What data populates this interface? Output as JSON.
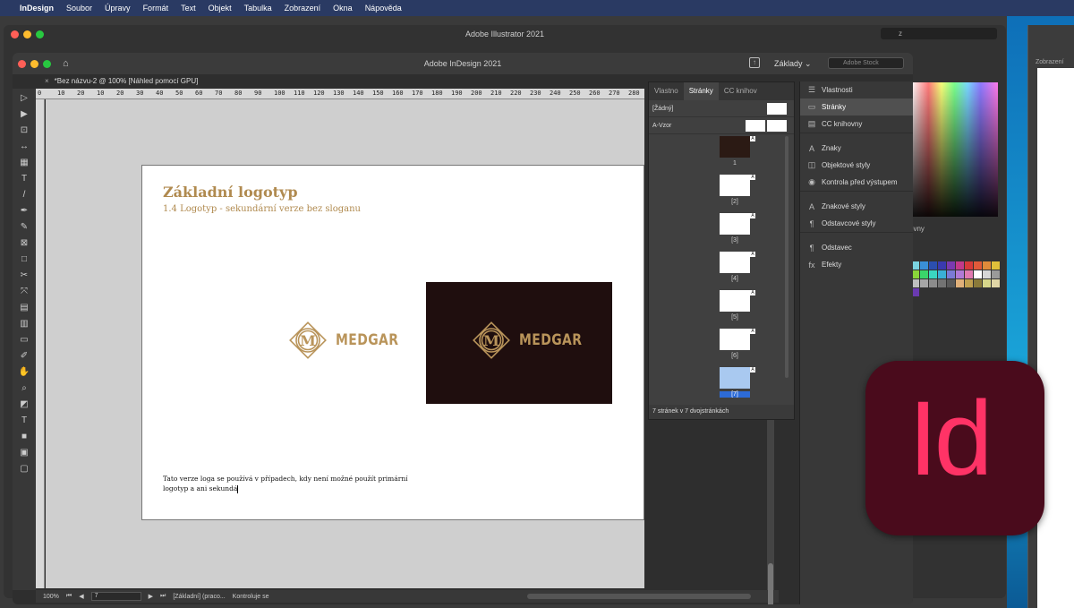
{
  "menubar": {
    "app": "InDesign",
    "items": [
      "Soubor",
      "Úpravy",
      "Formát",
      "Text",
      "Objekt",
      "Tabulka",
      "Zobrazení",
      "Okna",
      "Nápověda"
    ]
  },
  "illustrator": {
    "title": "Adobe Illustrator 2021",
    "search": "z",
    "swatch_label": "ovny",
    "swatches": [
      "#7ad3e0",
      "#3a8fd6",
      "#2b4fb0",
      "#3a3ab0",
      "#7a3ab0",
      "#c23a8a",
      "#d63a3a",
      "#e05a3a",
      "#e08a3a",
      "#e0c03a",
      "#8ad63a",
      "#3ad66a",
      "#3ad6c0",
      "#3ab0d6",
      "#7a7ad6",
      "#b07ad6",
      "#e07ab0",
      "#ffffff",
      "#d6d6d6",
      "#9a9a9a",
      "#bfbfbf",
      "#a6a6a6",
      "#8c8c8c",
      "#737373",
      "#595959",
      "#e0b07a",
      "#c0a050",
      "#8a7a3a",
      "#d6d68a",
      "#e0d6a6",
      "#6a3ab0"
    ]
  },
  "desktop": {
    "window_title": "Zobrazení"
  },
  "indesign": {
    "title": "Adobe InDesign 2021",
    "workspace": "Základy",
    "stock_placeholder": "Adobe Stock",
    "doc_tab": "*Bez názvu-2 @ 100% [Náhled pomocí GPU]",
    "ruler_marks": [
      "0",
      "10",
      "20",
      "10",
      "20",
      "30",
      "40",
      "50",
      "60",
      "70",
      "80",
      "90",
      "100",
      "110",
      "120",
      "130",
      "140",
      "150",
      "160",
      "170",
      "180",
      "190",
      "200",
      "210",
      "220",
      "230",
      "240",
      "250",
      "260",
      "270",
      "280"
    ]
  },
  "page": {
    "heading": "Základní logotyp",
    "subheading": "1.4 Logotyp - sekundární verze bez sloganu",
    "logo_word": "MEDGAR",
    "body": "Tato verze loga se používá v případech, kdy není možné použít primární logotyp a ani sekundá",
    "brand_gold": "#b08a4f",
    "brand_dark": "#1f0e0e"
  },
  "status": {
    "zoom": "100%",
    "page": "7",
    "profile": "[Základní] (praco...",
    "preflight": "Kontroluje se"
  },
  "pages_panel": {
    "tabs": [
      "Vlastno",
      "Stránky",
      "CC knihov"
    ],
    "none_label": "[Žádný]",
    "master_label": "A-Vzor",
    "pages": [
      "1",
      "[2]",
      "[3]",
      "[4]",
      "[5]",
      "[6]",
      "[7]"
    ],
    "footer": "7 stránek v 7 dvojstránkách"
  },
  "dock": {
    "items": [
      {
        "label": "Vlastnosti",
        "icon": "properties-icon"
      },
      {
        "label": "Stránky",
        "icon": "pages-icon"
      },
      {
        "label": "CC knihovny",
        "icon": "cc-libraries-icon"
      },
      {
        "label": "Znaky",
        "icon": "character-icon"
      },
      {
        "label": "Objektové styly",
        "icon": "object-styles-icon"
      },
      {
        "label": "Kontrola před výstupem",
        "icon": "preflight-icon"
      },
      {
        "label": "Znakové styly",
        "icon": "character-styles-icon"
      },
      {
        "label": "Odstavcové styly",
        "icon": "paragraph-styles-icon"
      },
      {
        "label": "Odstavec",
        "icon": "paragraph-icon"
      },
      {
        "label": "Efekty",
        "icon": "effects-icon"
      }
    ]
  },
  "id_logo": {
    "text": "Id",
    "bg": "#4a0b1c",
    "fg": "#ff3366"
  }
}
